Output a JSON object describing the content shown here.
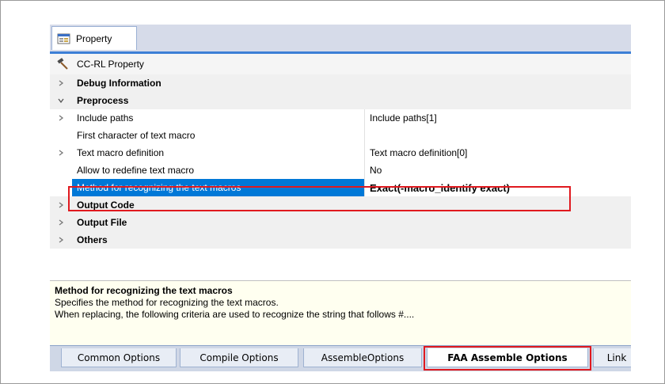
{
  "window": {
    "tab_title": "Property"
  },
  "header": {
    "title": "CC-RL Property"
  },
  "grid": {
    "rows": [
      {
        "type": "category",
        "expanded": false,
        "name": "Debug Information"
      },
      {
        "type": "category",
        "expanded": true,
        "name": "Preprocess"
      },
      {
        "type": "property",
        "expandable": true,
        "name": "Include paths",
        "value": "Include paths[1]"
      },
      {
        "type": "property",
        "expandable": false,
        "name": "First character of text macro",
        "value": ""
      },
      {
        "type": "property",
        "expandable": true,
        "name": "Text macro definition",
        "value": "Text macro definition[0]"
      },
      {
        "type": "property",
        "expandable": false,
        "name": "Allow to redefine text macro",
        "value": "No"
      },
      {
        "type": "property",
        "expandable": false,
        "selected": true,
        "name": "Method for recognizing the text macros",
        "value": "Exact(-macro_identify exact)"
      },
      {
        "type": "category",
        "expanded": false,
        "name": "Output Code"
      },
      {
        "type": "category",
        "expanded": false,
        "name": "Output File"
      },
      {
        "type": "category",
        "expanded": false,
        "name": "Others"
      }
    ]
  },
  "description": {
    "title": "Method for recognizing the text macros",
    "line1": "Specifies the method for recognizing the text macros.",
    "line2": "When replacing, the following criteria are used to recognize the string that follows #...."
  },
  "bottom_tabs": [
    {
      "label": "Common Options",
      "active": false
    },
    {
      "label": "Compile Options",
      "active": false
    },
    {
      "label": "AssembleOptions",
      "active": false
    },
    {
      "label": "FAA Assemble Options",
      "active": true
    },
    {
      "label": "Link",
      "active": false
    }
  ],
  "colors": {
    "selection": "#0078d7",
    "highlight_box": "#e0191f",
    "tab_accent": "#3c7fd6",
    "description_bg": "#fffff0"
  }
}
